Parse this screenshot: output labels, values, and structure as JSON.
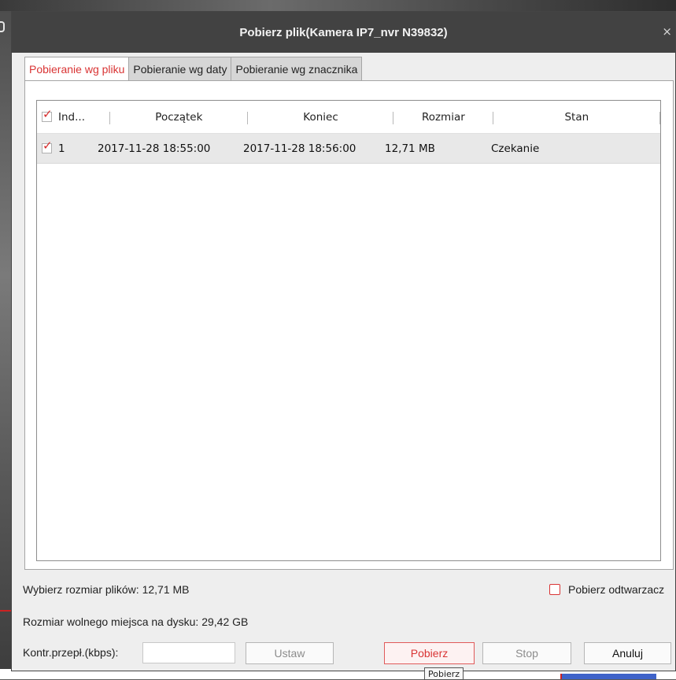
{
  "window": {
    "title": "Pobierz plik(Kamera IP7_nvr N39832)",
    "close_glyph": "×"
  },
  "tabs": [
    {
      "label": "Pobieranie wg pliku",
      "active": true
    },
    {
      "label": "Pobieranie wg daty",
      "active": false
    },
    {
      "label": "Pobieranie wg znacznika",
      "active": false
    }
  ],
  "table": {
    "columns": [
      "Ind...",
      "Początek",
      "Koniec",
      "Rozmiar",
      "Stan"
    ],
    "header_checked": true,
    "rows": [
      {
        "checked": true,
        "index": "1",
        "start": "2017-11-28 18:55:00",
        "end": "2017-11-28 18:56:00",
        "size": "12,71 MB",
        "state": "Czekanie"
      }
    ]
  },
  "info": {
    "selected_size": "Wybierz rozmiar plików:  12,71 MB",
    "free_space": "Rozmiar wolnego miejsca na dysku:  29,42 GB",
    "player_option": "Pobierz odtwarzacz"
  },
  "rate": {
    "label": "Kontr.przepł.(kbps):",
    "value": ""
  },
  "buttons": {
    "set": "Ustaw",
    "download": "Pobierz",
    "stop": "Stop",
    "cancel": "Anuluj"
  },
  "tooltip": "Pobierz",
  "colors": {
    "accent": "#d93434",
    "titlebar": "#424242"
  }
}
